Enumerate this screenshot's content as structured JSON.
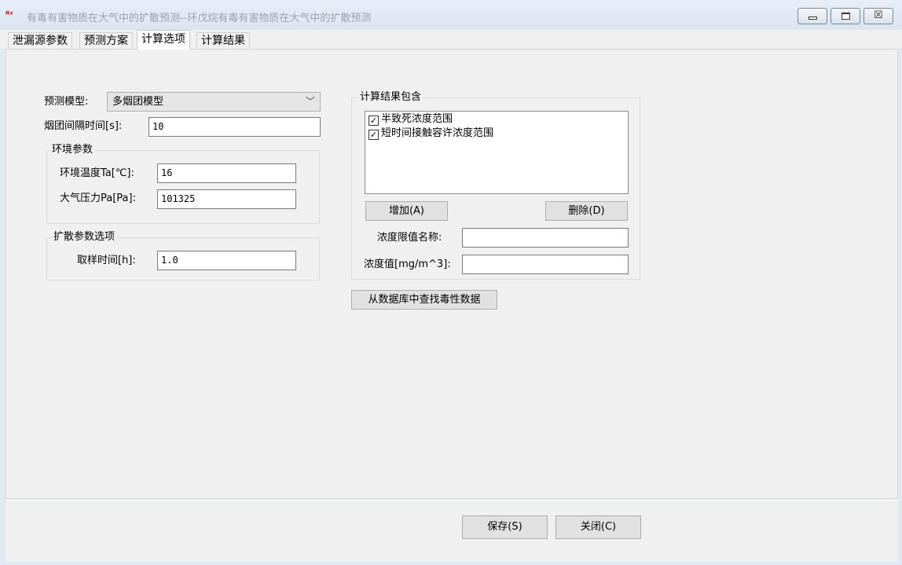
{
  "window": {
    "app_icon_glyph": "ᴿˢ",
    "title": "有毒有害物质在大气中的扩散预测--环戊烷有毒有害物质在大气中的扩散预测",
    "controls": {
      "minimize_icon": "minimize-icon",
      "maximize_icon": "maximize-icon",
      "close_glyph": "☒"
    }
  },
  "tabs": [
    {
      "label": "泄漏源参数"
    },
    {
      "label": "预测方案"
    },
    {
      "label": "计算选项"
    },
    {
      "label": "计算结果"
    }
  ],
  "active_tab_index": 2,
  "form": {
    "model_label": "预测模型:",
    "model_value": "多烟团模型",
    "interval_label": "烟团间隔时间[s]:",
    "interval_value": "10",
    "env_group_title": "环境参数",
    "temp_label": "环境温度Ta[℃]:",
    "temp_value": "16",
    "pressure_label": "大气压力Pa[Pa]:",
    "pressure_value": "101325",
    "diffusion_group_title": "扩散参数选项",
    "sampling_label": "取样时间[h]:",
    "sampling_value": "1.0"
  },
  "results": {
    "group_title": "计算结果包含",
    "items": [
      {
        "label": "半致死浓度范围",
        "checked": true
      },
      {
        "label": "短时间接触容许浓度范围",
        "checked": true
      }
    ],
    "add_button": "增加(A)",
    "delete_button": "删除(D)",
    "limit_name_label": "浓度限值名称:",
    "limit_name_value": "",
    "conc_label": "浓度值[mg/m^3]:",
    "conc_value": "",
    "lookup_button": "从数据库中查找毒性数据"
  },
  "footer": {
    "save_button": "保存(S)",
    "close_button": "关闭(C)"
  }
}
